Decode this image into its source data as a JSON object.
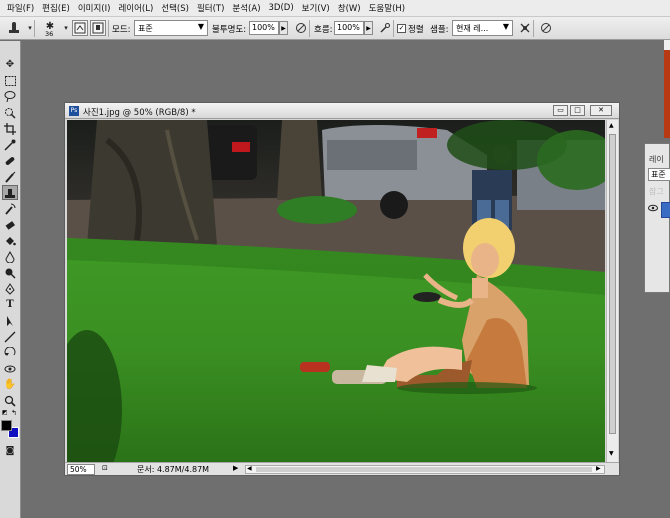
{
  "menu": [
    "파일(F)",
    "편집(E)",
    "이미지(I)",
    "레이어(L)",
    "선택(S)",
    "필터(T)",
    "분석(A)",
    "3D(D)",
    "보기(V)",
    "창(W)",
    "도움말(H)"
  ],
  "options": {
    "brush_size": "36",
    "mode_label": "모드:",
    "mode_value": "표준",
    "opacity_label": "불투명도:",
    "opacity_value": "100%",
    "flow_label": "흐름:",
    "flow_value": "100%",
    "aligned_label": "정렬",
    "aligned_checked": "✓",
    "sample_label": "샘플:",
    "sample_value": "현재 레..."
  },
  "document": {
    "title": "사진1.jpg @ 50% (RGB/8) *",
    "ps_badge": "Ps",
    "zoom": "50%",
    "doc_size": "문서: 4.87M/4.87M",
    "minimize": "▭",
    "maximize": "□",
    "close": "✕"
  },
  "panel": {
    "label": "레이",
    "blend": "표준",
    "lock_label": "잠그"
  },
  "toolbox": {
    "fg_color": "#000000",
    "bg_color": "#1010c0"
  },
  "icons": {
    "stamp": "clone-stamp-icon",
    "brush": "brush-preset-icon",
    "toggle_panel": "toggle-brush-panel-icon",
    "airbrush": "airbrush-icon",
    "ignore_adjust": "ignore-adjustment-layers-icon",
    "pressure": "pressure-icon"
  }
}
